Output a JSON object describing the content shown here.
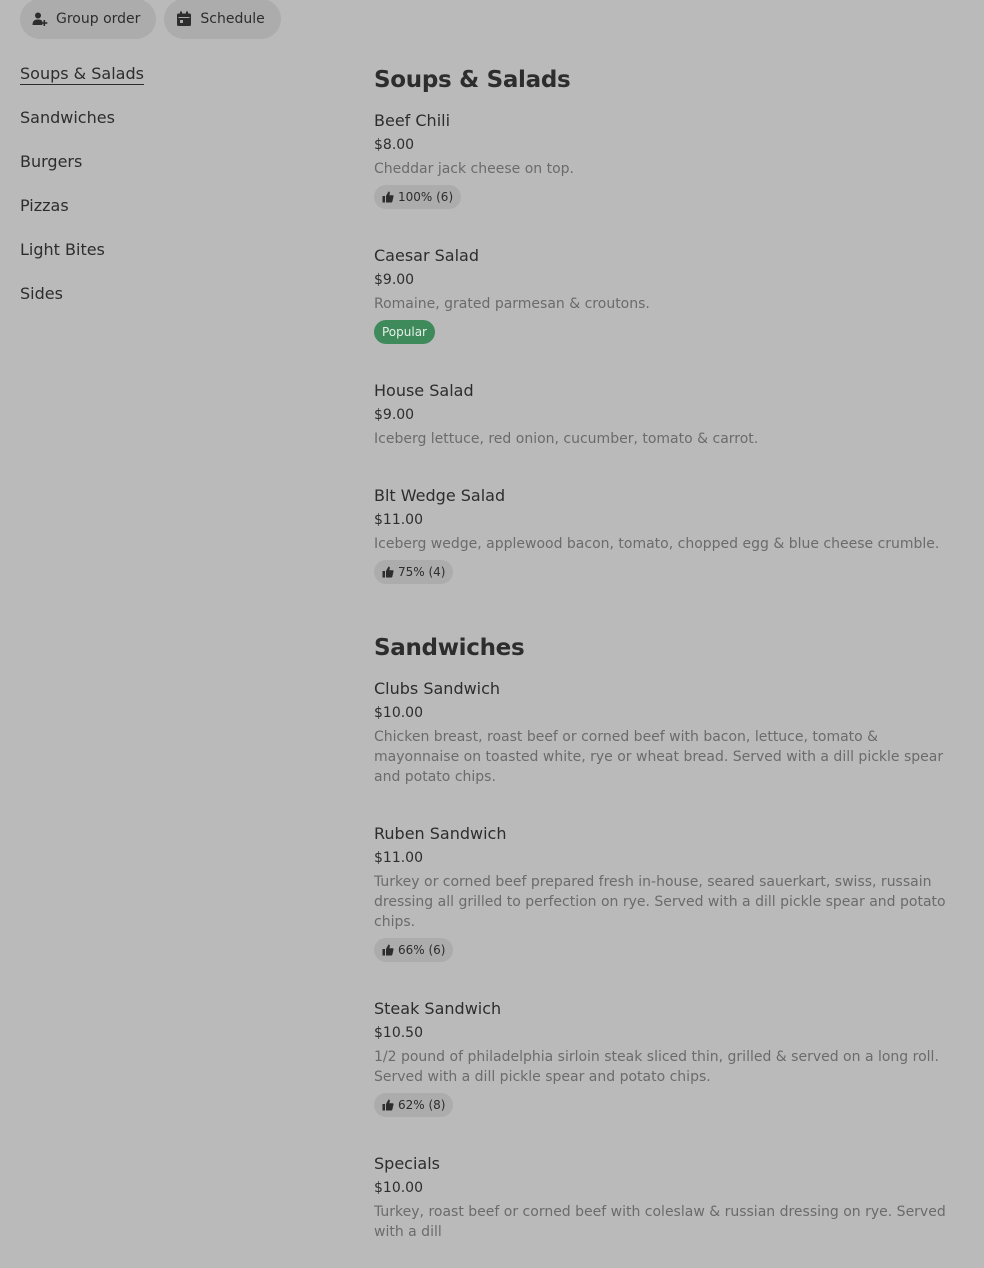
{
  "toolbar": {
    "group_order_label": "Group order",
    "schedule_label": "Schedule"
  },
  "sidebar": {
    "items": [
      {
        "label": "Soups & Salads",
        "active": true
      },
      {
        "label": "Sandwiches"
      },
      {
        "label": "Burgers"
      },
      {
        "label": "Pizzas"
      },
      {
        "label": "Light Bites"
      },
      {
        "label": "Sides"
      }
    ]
  },
  "sections": [
    {
      "title": "Soups & Salads",
      "items": [
        {
          "name": "Beef Chili",
          "price": "$8.00",
          "desc": "Cheddar jack cheese on top.",
          "rating": "100% (6)"
        },
        {
          "name": "Caesar Salad",
          "price": "$9.00",
          "desc": "Romaine, grated parmesan & croutons.",
          "badge": "Popular"
        },
        {
          "name": "House Salad",
          "price": "$9.00",
          "desc": "Iceberg lettuce, red onion, cucumber, tomato & carrot."
        },
        {
          "name": "Blt Wedge Salad",
          "price": "$11.00",
          "desc": "Iceberg wedge, applewood bacon, tomato, chopped egg & blue cheese crumble.",
          "rating": "75% (4)"
        }
      ]
    },
    {
      "title": "Sandwiches",
      "items": [
        {
          "name": "Clubs Sandwich",
          "price": "$10.00",
          "desc": "Chicken breast, roast beef or corned beef with bacon, lettuce, tomato & mayonnaise on toasted white, rye or wheat bread. Served with a dill pickle spear and potato chips."
        },
        {
          "name": "Ruben Sandwich",
          "price": "$11.00",
          "desc": "Turkey or corned beef prepared fresh in-house, seared sauerkart, swiss, russain dressing all grilled to perfection on rye. Served with a dill pickle spear and potato chips.",
          "rating": "66% (6)"
        },
        {
          "name": "Steak Sandwich",
          "price": "$10.50",
          "desc": "1/2 pound of philadelphia sirloin steak sliced thin, grilled & served on a long roll. Served with a dill pickle spear and potato chips.",
          "rating": "62% (8)"
        },
        {
          "name": "Specials",
          "price": "$10.00",
          "desc": "Turkey, roast beef or corned beef with coleslaw & russian dressing on rye. Served with a dill"
        }
      ]
    }
  ]
}
